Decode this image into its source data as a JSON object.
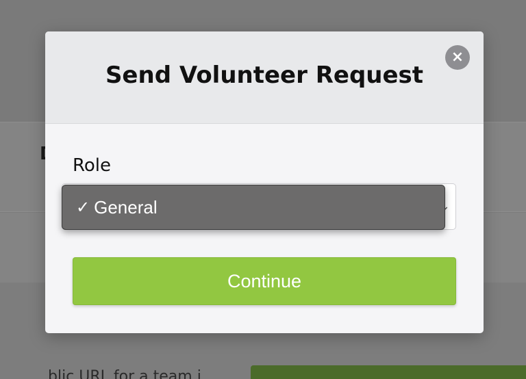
{
  "background": {
    "band_text": "D",
    "bottom_text": "blic URL for a team i",
    "bottom_button_label": ""
  },
  "modal": {
    "title": "Send Volunteer Request",
    "close_label": "×",
    "role_label": "Role",
    "role_select": {
      "selected": "General",
      "options": [
        "General"
      ],
      "check_mark": "✓"
    },
    "continue_label": "Continue"
  },
  "colors": {
    "overlay": "#7b7b7b",
    "modal_bg": "#f5f5f7",
    "header_bg": "#e8e9eb",
    "continue_green": "#92c741",
    "dropdown_bg": "#6c6b6b"
  }
}
